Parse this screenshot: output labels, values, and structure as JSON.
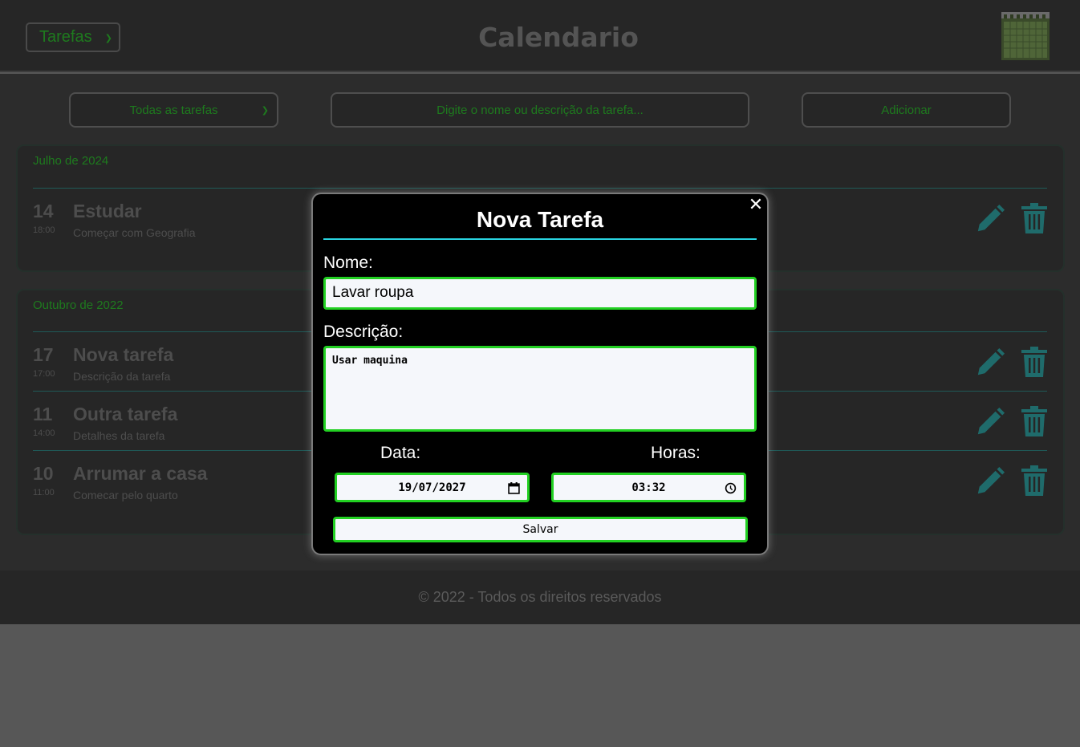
{
  "header": {
    "view_select": "Tarefas",
    "title": "Calendario",
    "calendar_icon": "calendar-icon"
  },
  "controls": {
    "filter_select": "Todas as tarefas",
    "search_placeholder": "Digite o nome ou descrição da tarefa...",
    "add_label": "Adicionar"
  },
  "months": [
    {
      "title": "Julho de 2024",
      "tasks": [
        {
          "day": "14",
          "time": "18:00",
          "name": "Estudar",
          "desc": "Começar com Geografia"
        }
      ]
    },
    {
      "title": "Outubro de 2022",
      "tasks": [
        {
          "day": "17",
          "time": "17:00",
          "name": "Nova tarefa",
          "desc": "Descrição da tarefa"
        },
        {
          "day": "11",
          "time": "14:00",
          "name": "Outra tarefa",
          "desc": "Detalhes da tarefa"
        },
        {
          "day": "10",
          "time": "11:00",
          "name": "Arrumar a casa",
          "desc": "Comecar pelo quarto"
        }
      ]
    }
  ],
  "footer": {
    "text": "© 2022 - Todos os direitos reservados"
  },
  "modal": {
    "title": "Nova Tarefa",
    "close": "✕",
    "name_label": "Nome:",
    "name_value": "Lavar roupa",
    "desc_label": "Descrição:",
    "desc_value": "Usar maquina",
    "date_label": "Data:",
    "date_value": "19/07/2027",
    "hours_label": "Horas:",
    "hours_value": "03:32",
    "save_label": "Salvar"
  },
  "colors": {
    "accent_green": "#22d022",
    "accent_cyan": "#29d3e0",
    "icon_teal": "#1f6b6b",
    "text_dim_green": "#1e7a1e"
  }
}
